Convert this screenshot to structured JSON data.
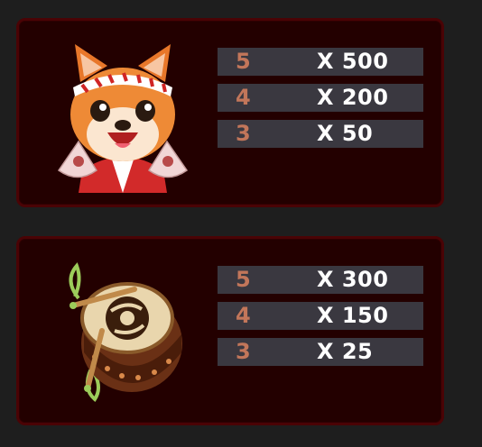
{
  "paytable": [
    {
      "symbol": "shiba-dog-icon",
      "rows": [
        {
          "count": "5",
          "multiplier": "X 500"
        },
        {
          "count": "4",
          "multiplier": "X 200"
        },
        {
          "count": "3",
          "multiplier": "X 50"
        }
      ]
    },
    {
      "symbol": "taiko-drum-icon",
      "rows": [
        {
          "count": "5",
          "multiplier": "X 300"
        },
        {
          "count": "4",
          "multiplier": "X 150"
        },
        {
          "count": "3",
          "multiplier": "X 25"
        }
      ]
    }
  ],
  "colors": {
    "background": "#1e1e1e",
    "panel": "#230000",
    "panel_border": "#4a0305",
    "row_background": "#3a3840",
    "count_text": "#c2765a",
    "multiplier_text": "#ffffff"
  }
}
